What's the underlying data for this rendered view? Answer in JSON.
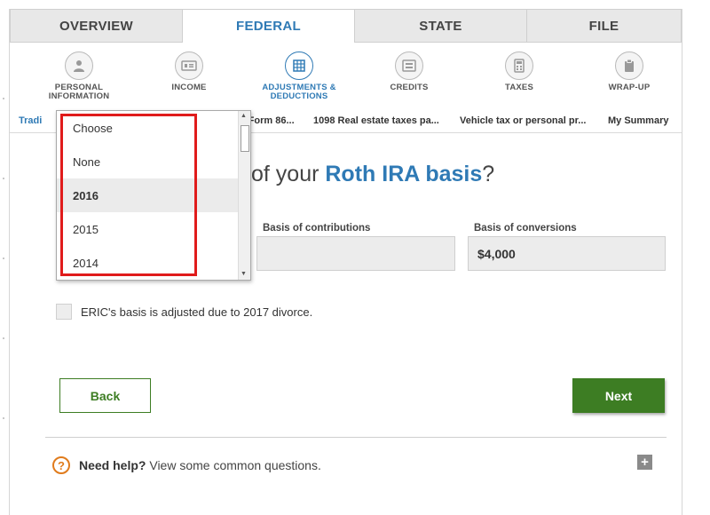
{
  "tabs": [
    "OVERVIEW",
    "FEDERAL",
    "STATE",
    "FILE"
  ],
  "steps": [
    {
      "label": "PERSONAL\nINFORMATION",
      "icon": "person-icon"
    },
    {
      "label": "INCOME",
      "icon": "money-icon"
    },
    {
      "label": "ADJUSTMENTS &\nDEDUCTIONS",
      "icon": "ledger-icon"
    },
    {
      "label": "CREDITS",
      "icon": "credits-icon"
    },
    {
      "label": "TAXES",
      "icon": "calculator-icon"
    },
    {
      "label": "WRAP-UP",
      "icon": "clipboard-icon"
    }
  ],
  "subtabs": [
    "Tradi",
    "(Form 86...",
    "1098 Real estate taxes pa...",
    "Vehicle tax or personal pr...",
    "My Summary"
  ],
  "question": {
    "prefix": "of your ",
    "highlight": "Roth IRA basis",
    "suffix": "?"
  },
  "fields": {
    "contributions": {
      "label": "Basis of contributions",
      "value": ""
    },
    "conversions": {
      "label": "Basis of conversions",
      "value": "$4,000"
    }
  },
  "checkbox": {
    "label": "ERIC's basis is adjusted due to 2017 divorce.",
    "checked": false
  },
  "buttons": {
    "back": "Back",
    "next": "Next"
  },
  "help": {
    "bold": "Need help?",
    "text": " View some common questions.",
    "icon": "?",
    "expand": "+"
  },
  "dropdown": {
    "options": [
      "Choose",
      "None",
      "2016",
      "2015",
      "2014"
    ],
    "selected": "2016"
  },
  "colors": {
    "accent": "#2f7ab5",
    "primary_button": "#3d7d23",
    "highlight": "#e01b1b",
    "help": "#e07b1c"
  }
}
